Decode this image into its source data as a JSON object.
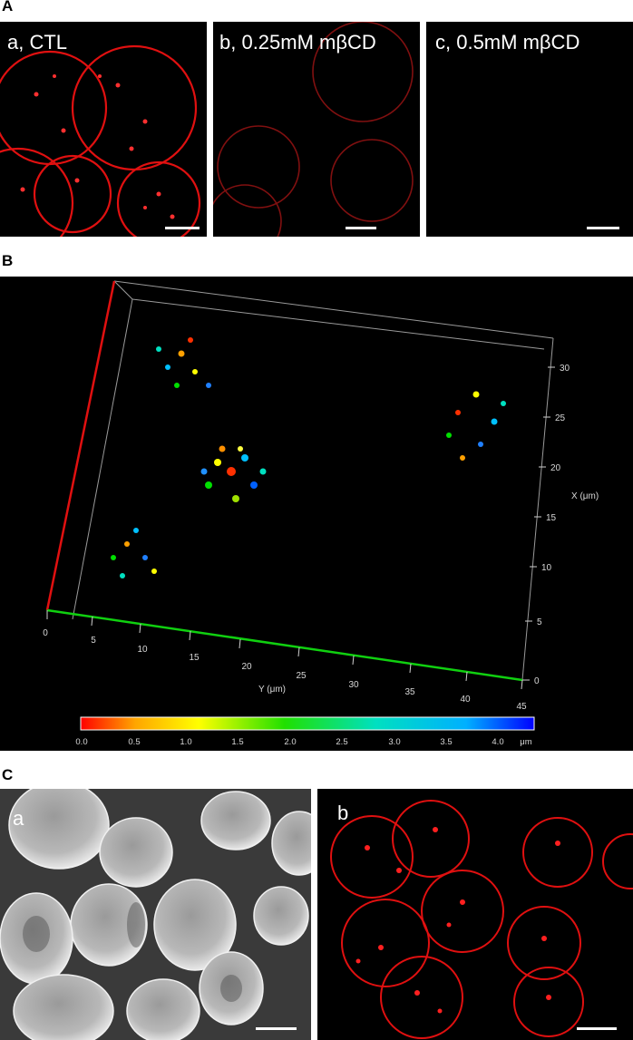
{
  "figure": {
    "panel_labels": {
      "A": "A",
      "B": "B",
      "C": "C"
    },
    "panel_A": {
      "a": "a, CTL",
      "b": "b, 0.25mM mβCD",
      "c": "c, 0.5mM mβCD"
    },
    "panel_B": {
      "x_axis_label": "X (μm)",
      "y_axis_label": "Y (μm)",
      "x_ticks": [
        "0",
        "5",
        "10",
        "15",
        "20",
        "25",
        "30"
      ],
      "y_ticks": [
        "0",
        "5",
        "10",
        "15",
        "20",
        "25",
        "30",
        "35",
        "40",
        "45"
      ],
      "colorbar_ticks": [
        "0.0",
        "0.5",
        "1.0",
        "1.5",
        "2.0",
        "2.5",
        "3.0",
        "3.5",
        "4.0"
      ],
      "colorbar_unit": "μm",
      "colorbar_colors": [
        "#ff0000",
        "#ffa500",
        "#ffff00",
        "#a0e000",
        "#00d000",
        "#00e0c0",
        "#00c0ff",
        "#0060ff",
        "#0000ff"
      ]
    },
    "panel_C": {
      "a": "a",
      "b": "b"
    }
  }
}
